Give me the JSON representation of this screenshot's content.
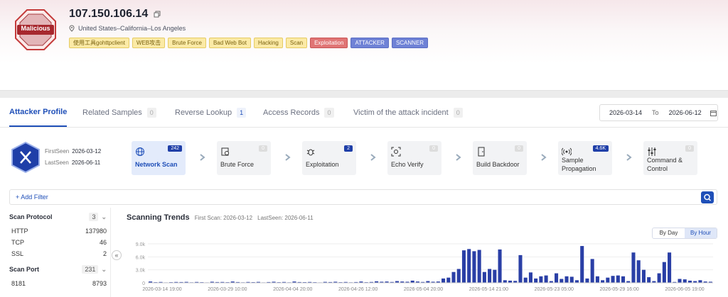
{
  "header": {
    "verdict": "Malicious",
    "ip": "107.150.106.14",
    "location": "United States–California–Los Angeles",
    "tags": [
      {
        "label": "使用工具gohttpclient",
        "style": "yellow"
      },
      {
        "label": "WEB攻击",
        "style": "yellow"
      },
      {
        "label": "Brute Force",
        "style": "yellow"
      },
      {
        "label": "Bad Web Bot",
        "style": "yellow"
      },
      {
        "label": "Hacking",
        "style": "yellow"
      },
      {
        "label": "Scan",
        "style": "yellow"
      },
      {
        "label": "Exploitation",
        "style": "red"
      },
      {
        "label": "ATTACKER",
        "style": "blue"
      },
      {
        "label": "SCANNER",
        "style": "blue"
      }
    ]
  },
  "tabs": [
    {
      "label": "Attacker Profile",
      "count": ""
    },
    {
      "label": "Related Samples",
      "count": "0"
    },
    {
      "label": "Reverse Lookup",
      "count": "1"
    },
    {
      "label": "Access Records",
      "count": "0"
    },
    {
      "label": "Victim of the attack incident",
      "count": "0"
    }
  ],
  "date_range": {
    "start": "2026-03-14",
    "to_label": "To",
    "end": "2026-06-12"
  },
  "profile": {
    "first_seen_label": "FirstSeen",
    "first_seen": "2026-03-12",
    "last_seen_label": "LastSeen",
    "last_seen": "2026-06-11"
  },
  "kill_chain": [
    {
      "label": "Network Scan",
      "count": "242",
      "icon": "globe-icon",
      "selected": true
    },
    {
      "label": "Brute Force",
      "count": "0",
      "icon": "key-icon",
      "selected": false
    },
    {
      "label": "Exploitation",
      "count": "2",
      "icon": "bug-icon",
      "selected": false
    },
    {
      "label": "Echo Verify",
      "count": "0",
      "icon": "scan-icon",
      "selected": false
    },
    {
      "label": "Build Backdoor",
      "count": "0",
      "icon": "door-icon",
      "selected": false
    },
    {
      "label": "Sample Propagation",
      "count": "4.6K",
      "icon": "broadcast-icon",
      "selected": false
    },
    {
      "label": "Command & Control",
      "count": "0",
      "icon": "sliders-icon",
      "selected": false
    }
  ],
  "filter": {
    "add_label": "+ Add Filter"
  },
  "sidebar": {
    "scan_protocol": {
      "title": "Scan Protocol",
      "count": "3",
      "items": [
        {
          "name": "HTTP",
          "value": "137980"
        },
        {
          "name": "TCP",
          "value": "46"
        },
        {
          "name": "SSL",
          "value": "2"
        }
      ]
    },
    "scan_port": {
      "title": "Scan Port",
      "count": "231",
      "items": [
        {
          "name": "8181",
          "value": "8793"
        }
      ]
    }
  },
  "trends": {
    "title": "Scanning Trends",
    "first_scan": "First Scan: 2026-03-12",
    "last_seen": "LastSeen: 2026-06-11",
    "toggle": {
      "by_day": "By Day",
      "by_hour": "By Hour",
      "active": "by_hour"
    }
  },
  "chart_data": {
    "type": "bar",
    "ylabel": "",
    "yticks": [
      "9.0k",
      "6.0k",
      "3.0k",
      "0"
    ],
    "ylim": [
      0,
      9000
    ],
    "xticks": [
      "2026-03-14 19:00",
      "2026-03-29 10:00",
      "2026-04-04 20:00",
      "2026-04-26 12:00",
      "2026-05-04 20:00",
      "2026-05-14 21:00",
      "2026-05-23 05:00",
      "2026-05-29 16:00",
      "2026-06-05 19:00"
    ],
    "series": [
      {
        "name": "",
        "color": "#2a3fa6",
        "values": [
          300,
          150,
          200,
          100,
          150,
          200,
          180,
          220,
          120,
          200,
          150,
          100,
          250,
          180,
          200,
          150,
          300,
          180,
          120,
          200,
          160,
          220,
          100,
          180,
          250,
          150,
          200,
          120,
          300,
          180,
          160,
          200,
          150,
          100,
          220,
          180,
          250,
          150,
          200,
          120,
          180,
          300,
          150,
          200,
          350,
          250,
          300,
          200,
          400,
          300,
          250,
          500,
          300,
          200,
          400,
          250,
          300,
          1000,
          1200,
          2500,
          3200,
          7500,
          7800,
          7300,
          7600,
          2500,
          3200,
          3000,
          7700,
          600,
          500,
          450,
          6400,
          1200,
          2400,
          1000,
          1500,
          1700,
          400,
          2200,
          900,
          1500,
          1400,
          600,
          8500,
          1000,
          5500,
          1500,
          600,
          1200,
          1600,
          1700,
          1500,
          400,
          7000,
          5200,
          3000,
          1300,
          400,
          2200,
          4800,
          7000,
          200,
          900,
          800,
          500,
          400,
          600,
          300,
          250
        ]
      }
    ]
  }
}
